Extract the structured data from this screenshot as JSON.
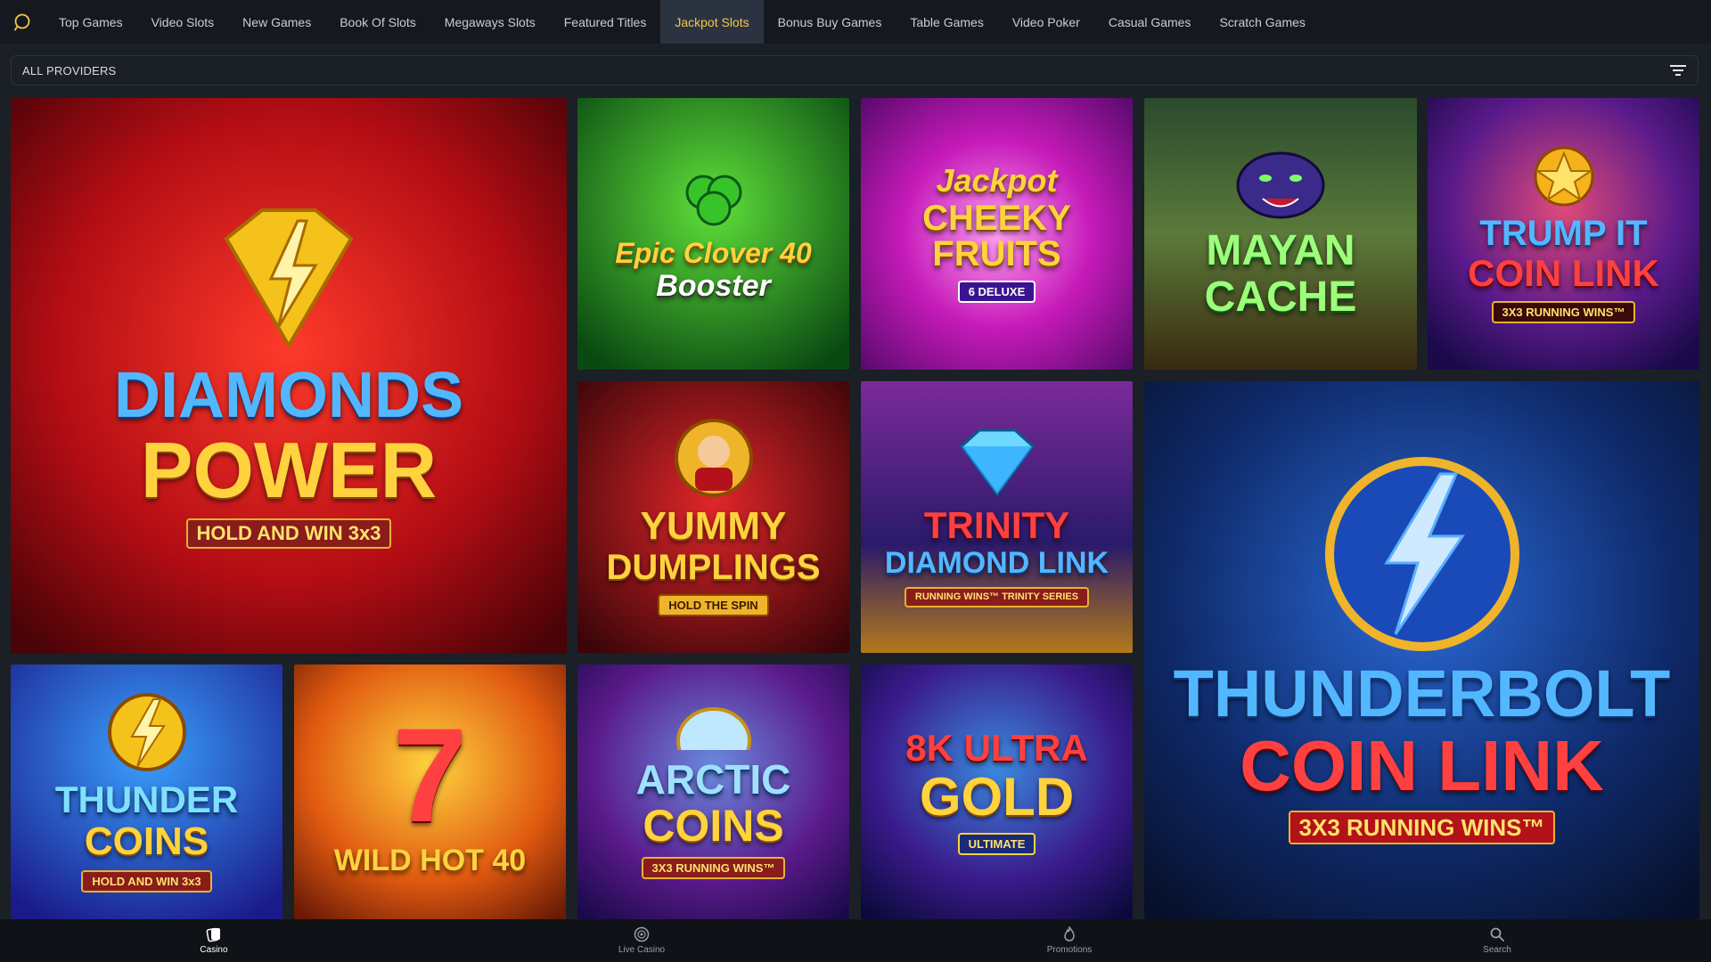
{
  "nav": {
    "search_icon": "search-icon",
    "tabs": [
      {
        "label": "Top Games"
      },
      {
        "label": "Video Slots"
      },
      {
        "label": "New Games"
      },
      {
        "label": "Book Of Slots"
      },
      {
        "label": "Megaways Slots"
      },
      {
        "label": "Featured Titles"
      },
      {
        "label": "Jackpot Slots",
        "active": true
      },
      {
        "label": "Bonus Buy Games"
      },
      {
        "label": "Table Games"
      },
      {
        "label": "Video Poker"
      },
      {
        "label": "Casual Games"
      },
      {
        "label": "Scratch Games"
      }
    ]
  },
  "providers": {
    "label": "ALL PROVIDERS",
    "filter_icon": "filter-icon"
  },
  "games": [
    {
      "line1": "DIAMONDS",
      "line2": "POWER",
      "badge": "HOLD AND WIN 3x3"
    },
    {
      "line1": "Epic Clover 40",
      "line2": "Booster",
      "badge": ""
    },
    {
      "line1": "Jackpot",
      "line2": "CHEEKY FRUITS",
      "badge": "6 DELUXE"
    },
    {
      "line1": "MAYAN",
      "line2": "CACHE",
      "badge": ""
    },
    {
      "line1": "TRUMP IT",
      "line2": "COIN LINK",
      "badge": "3X3 RUNNING WINS™"
    },
    {
      "line1": "YUMMY",
      "line2": "DUMPLINGS",
      "badge": "HOLD THE SPIN"
    },
    {
      "line1": "TRINITY",
      "line2": "DIAMOND LINK",
      "badge": "RUNNING WINS™ TRINITY SERIES"
    },
    {
      "line1": "THUNDERBOLT",
      "line2": "COIN LINK",
      "badge": "3X3 RUNNING WINS™"
    },
    {
      "line1": "THUNDER",
      "line2": "COINS",
      "badge": "HOLD AND WIN 3x3"
    },
    {
      "line1": "7",
      "line2": "WILD HOT 40",
      "badge": ""
    },
    {
      "line1": "ARCTIC",
      "line2": "COINS",
      "badge": "3X3 RUNNING WINS™"
    },
    {
      "line1": "8K ULTRA",
      "line2": "GOLD",
      "badge": "ULTIMATE"
    }
  ],
  "bottom_nav": [
    {
      "label": "Casino",
      "icon": "cards-icon",
      "active": true
    },
    {
      "label": "Live Casino",
      "icon": "roulette-icon"
    },
    {
      "label": "Promotions",
      "icon": "flame-icon"
    },
    {
      "label": "Search",
      "icon": "search-icon"
    }
  ],
  "colors": {
    "active_tab_text": "#f2c94c",
    "active_tab_bg": "#2c3340",
    "nav_bg": "#15191f",
    "page_bg": "#1b1f26"
  }
}
